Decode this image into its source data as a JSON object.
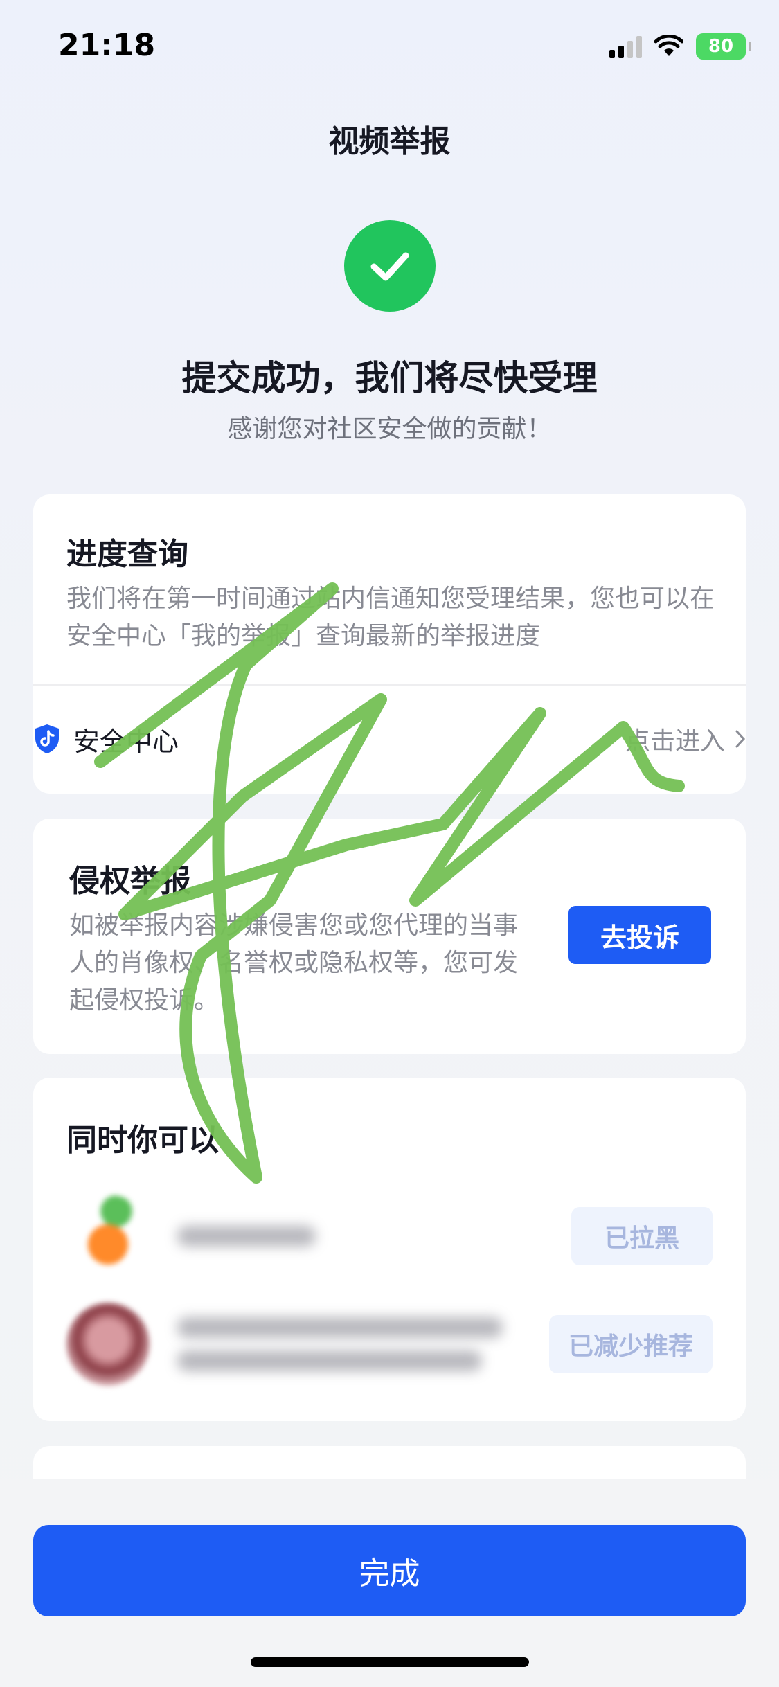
{
  "status_bar": {
    "time": "21:18",
    "battery": "80"
  },
  "header": {
    "title": "视频举报"
  },
  "success": {
    "title": "提交成功，我们将尽快受理",
    "subtitle": "感谢您对社区安全做的贡献！"
  },
  "progress_card": {
    "title": "进度查询",
    "description": "我们将在第一时间通过站内信通知您受理结果，您也可以在安全中心「我的举报」查询最新的举报进度",
    "link_label": "安全中心",
    "link_action": "点击进入"
  },
  "rights_card": {
    "title": "侵权举报",
    "description": "如被举报内容涉嫌侵害您或您代理的当事人的肖像权、名誉权或隐私权等，您可发起侵权投诉。",
    "button": "去投诉"
  },
  "also_card": {
    "title": "同时你可以",
    "items": [
      {
        "status": "已拉黑"
      },
      {
        "status": "已减少推荐"
      }
    ]
  },
  "footer": {
    "done": "完成"
  },
  "colors": {
    "accent": "#1e5cf4",
    "success": "#21c55d",
    "scribble": "#74c054"
  }
}
